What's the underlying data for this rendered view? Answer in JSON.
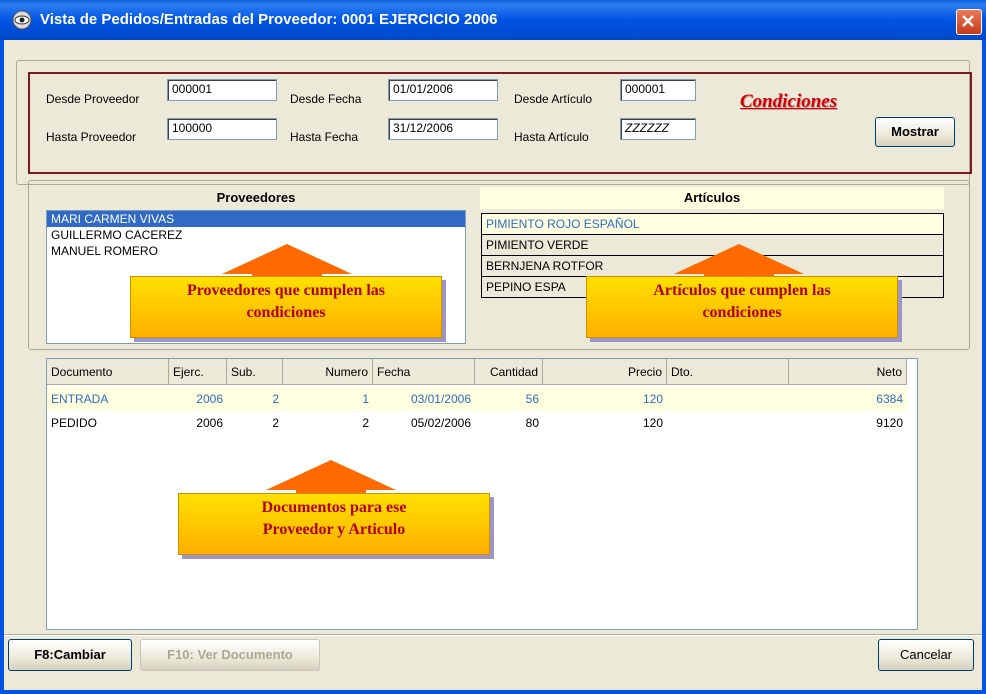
{
  "window": {
    "title": "Vista de Pedidos/Entradas del Proveedor: 0001 EJERCICIO 2006",
    "close_glyph": "✕",
    "icon": "eye-icon"
  },
  "conditions": {
    "desde_proveedor_label": "Desde Proveedor",
    "desde_proveedor_value": "000001",
    "hasta_proveedor_label": "Hasta Proveedor",
    "hasta_proveedor_value": "100000",
    "desde_fecha_label": "Desde Fecha",
    "desde_fecha_value": "01/01/2006",
    "hasta_fecha_label": "Hasta Fecha",
    "hasta_fecha_value": "31/12/2006",
    "desde_articulo_label": "Desde Artículo",
    "desde_articulo_value": "000001",
    "hasta_articulo_label": "Hasta Artículo",
    "hasta_articulo_value": "ZZZZZZ",
    "condiciones_caption": "Condiciones",
    "mostrar_label": "Mostrar"
  },
  "proveedores": {
    "header": "Proveedores",
    "items": [
      "MARI CARMEN VIVAS",
      "GUILLERMO CACEREZ",
      "MANUEL ROMERO"
    ],
    "selected_index": 0
  },
  "articulos": {
    "header": "Artículos",
    "items": [
      "PIMIENTO ROJO ESPAÑOL",
      "PIMIENTO VERDE",
      "BERNJENA ROTFOR",
      "PEPINO ESPA"
    ],
    "selected_index": 0
  },
  "documents": {
    "columns": [
      "Documento",
      "Ejerc.",
      "Sub.",
      "Numero",
      "Fecha",
      "Cantidad",
      "Precio",
      "Dto.",
      "Neto"
    ],
    "rows": [
      {
        "documento": "ENTRADA",
        "ejerc": "2006",
        "sub": "2",
        "numero": "1",
        "fecha": "03/01/2006",
        "cantidad": "56",
        "precio": "120",
        "dto": "",
        "neto": "6384"
      },
      {
        "documento": "PEDIDO",
        "ejerc": "2006",
        "sub": "2",
        "numero": "2",
        "fecha": "05/02/2006",
        "cantidad": "80",
        "precio": "120",
        "dto": "",
        "neto": "9120"
      }
    ]
  },
  "callouts": {
    "proveedores": [
      "Proveedores que cumplen las",
      "condiciones"
    ],
    "articulos": [
      "Artículos que cumplen las",
      "condiciones"
    ],
    "documentos": [
      "Documentos para ese",
      "Proveedor y Articulo"
    ]
  },
  "footer": {
    "f8_label": "F8:Cambiar",
    "f10_label": "F10: Ver Documento",
    "cancel_label": "Cancelar"
  },
  "colors": {
    "titlebar": "#0054e3",
    "selection": "#316ac5",
    "entrada_row_text": "#316ac5",
    "conditions_border": "#7a1a22",
    "condiciones_text": "#d40000",
    "callout_fill": "#ffc800",
    "callout_text": "#b30000",
    "arrow": "#ff5a00"
  }
}
